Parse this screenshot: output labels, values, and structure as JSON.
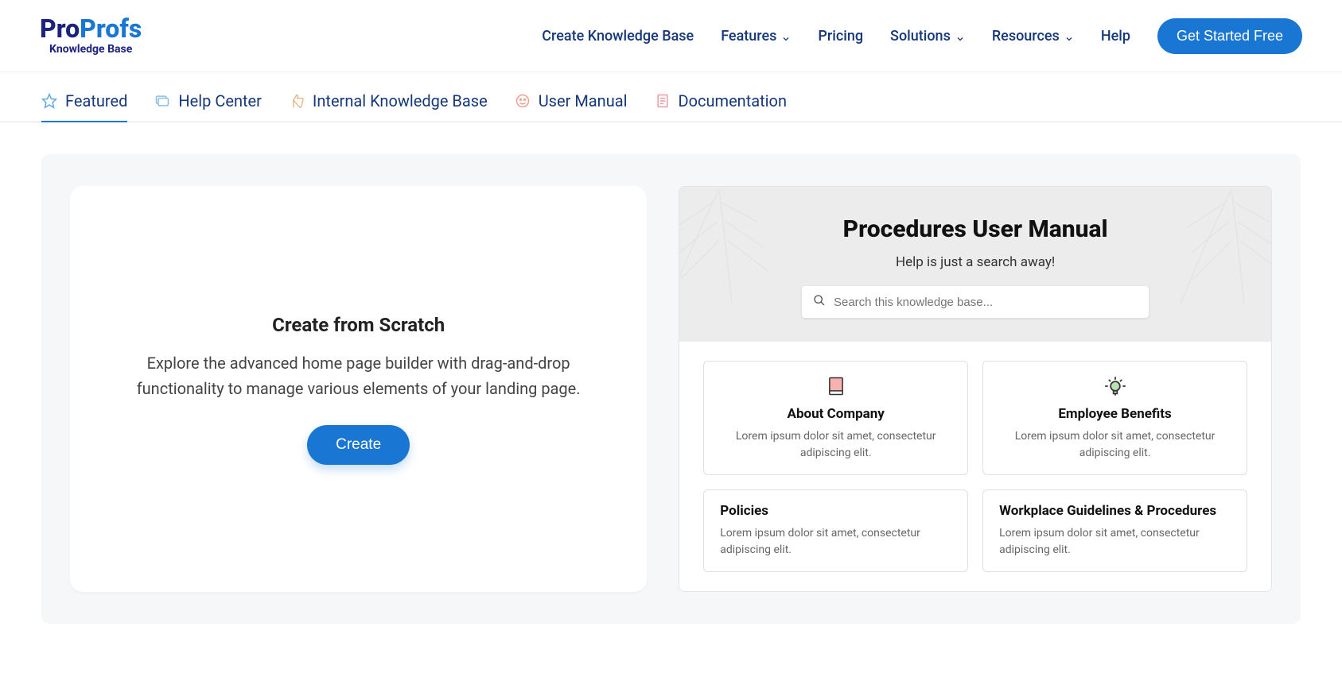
{
  "header": {
    "logo_part1": "Pro",
    "logo_part2": "Profs",
    "logo_sub": "Knowledge Base",
    "nav": {
      "create": "Create Knowledge Base",
      "features": "Features",
      "pricing": "Pricing",
      "solutions": "Solutions",
      "resources": "Resources",
      "help": "Help"
    },
    "cta": "Get Started Free"
  },
  "tabs": {
    "featured": "Featured",
    "help_center": "Help Center",
    "internal_kb": "Internal Knowledge Base",
    "user_manual": "User Manual",
    "documentation": "Documentation"
  },
  "scratch": {
    "title": "Create from Scratch",
    "desc": "Explore the advanced home page builder with drag-and-drop functionality to manage various elements of your landing page.",
    "button": "Create"
  },
  "preview": {
    "title": "Procedures User Manual",
    "subtitle": "Help is just a search away!",
    "search_placeholder": "Search this knowledge base...",
    "cards": [
      {
        "title": "About Company",
        "desc": "Lorem ipsum dolor sit amet, consectetur adipiscing elit."
      },
      {
        "title": "Employee Benefits",
        "desc": "Lorem ipsum dolor sit amet, consectetur adipiscing elit."
      },
      {
        "title": "Policies",
        "desc": "Lorem ipsum dolor sit amet, consectetur adipiscing elit."
      },
      {
        "title": "Workplace Guidelines & Procedures",
        "desc": "Lorem ipsum dolor sit amet, consectetur adipiscing elit."
      }
    ]
  }
}
